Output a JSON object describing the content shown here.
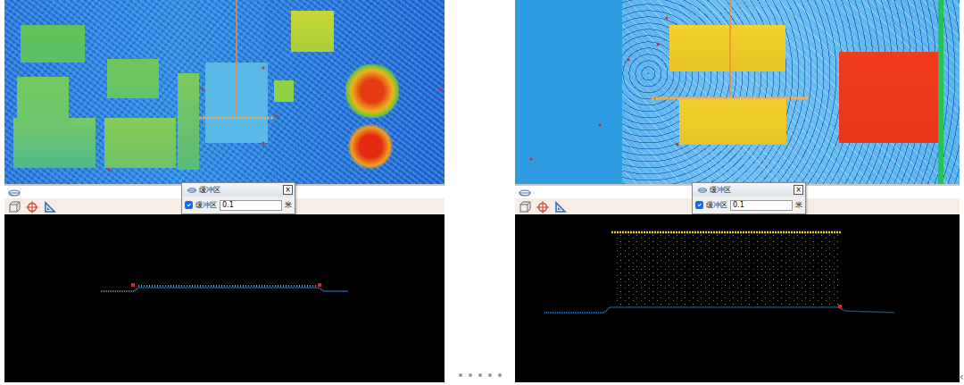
{
  "panels": [
    {
      "dialog": {
        "title": "缓冲区",
        "close": "×",
        "checkbox": {
          "label": "缓冲区",
          "checked": true
        },
        "value": "0.1",
        "unit": "米"
      }
    },
    {
      "dialog": {
        "title": "缓冲区",
        "close": "×",
        "checkbox": {
          "label": "缓冲区",
          "checked": true
        },
        "value": "0.1",
        "unit": "米"
      }
    }
  ],
  "pager": {
    "dots": [
      {
        "selected": false
      },
      {
        "selected": false
      },
      {
        "selected": false
      },
      {
        "selected": false
      },
      {
        "selected": false
      }
    ]
  },
  "edge_arrow": "‹"
}
